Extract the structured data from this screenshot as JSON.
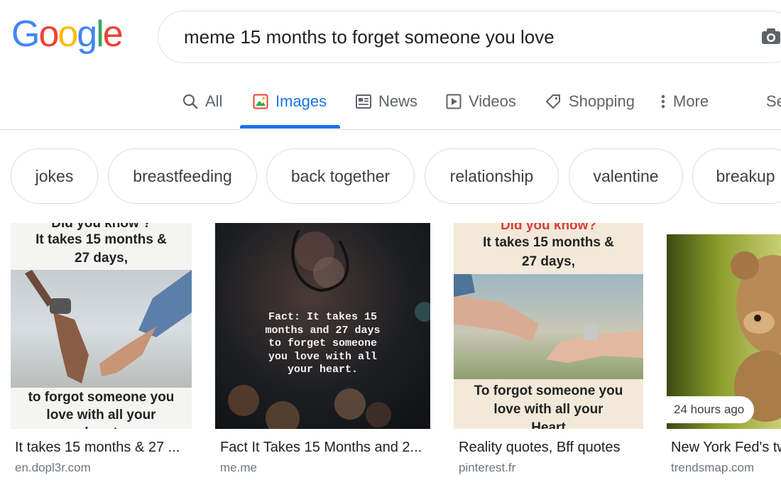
{
  "logo": {
    "letters": [
      "G",
      "o",
      "o",
      "g",
      "l",
      "e"
    ],
    "colors": [
      "#4285F4",
      "#EA4335",
      "#FBBC05",
      "#4285F4",
      "#34A853",
      "#EA4335"
    ]
  },
  "search": {
    "query": "meme 15 months to forget someone you love"
  },
  "tabs": [
    {
      "label": "All",
      "icon": "search-icon"
    },
    {
      "label": "Images",
      "icon": "image-icon",
      "active": true
    },
    {
      "label": "News",
      "icon": "news-icon"
    },
    {
      "label": "Videos",
      "icon": "video-icon"
    },
    {
      "label": "Shopping",
      "icon": "tag-icon"
    },
    {
      "label": "More",
      "icon": "more-vert-icon"
    },
    {
      "label": "Se"
    }
  ],
  "chips": [
    "jokes",
    "breastfeeding",
    "back together",
    "relationship",
    "valentine",
    "breakup"
  ],
  "results": [
    {
      "caption": "It takes 15 months & 27 ...",
      "source": "en.dopl3r.com",
      "image_text": {
        "top": "Did you know ?",
        "line1": "It takes 15 months &",
        "line2": "27 days,",
        "bottom1": "to forgot someone you",
        "bottom2": "love with all your",
        "bottom3": "heart"
      }
    },
    {
      "caption": "Fact It Takes 15 Months and 2...",
      "source": "me.me",
      "image_text": {
        "line1": "Fact: It takes 15",
        "line2": "months and 27 days",
        "line3": "to forget someone",
        "line4": "you love with all",
        "line5": "your heart."
      }
    },
    {
      "caption": "Reality quotes, Bff quotes",
      "source": "pinterest.fr",
      "image_text": {
        "top": "Did you know?",
        "line1": "It takes 15 months &",
        "line2": "27 days,",
        "bottom1": "To forgot someone you",
        "bottom2": "love with all your",
        "bottom3": "Heart"
      }
    },
    {
      "caption": "New York Fed's tw",
      "source": "trendsmap.com",
      "badge": "24 hours ago"
    }
  ],
  "colors": {
    "accent": "#1a73e8",
    "muted": "#5f6368",
    "border": "#dadce0"
  }
}
